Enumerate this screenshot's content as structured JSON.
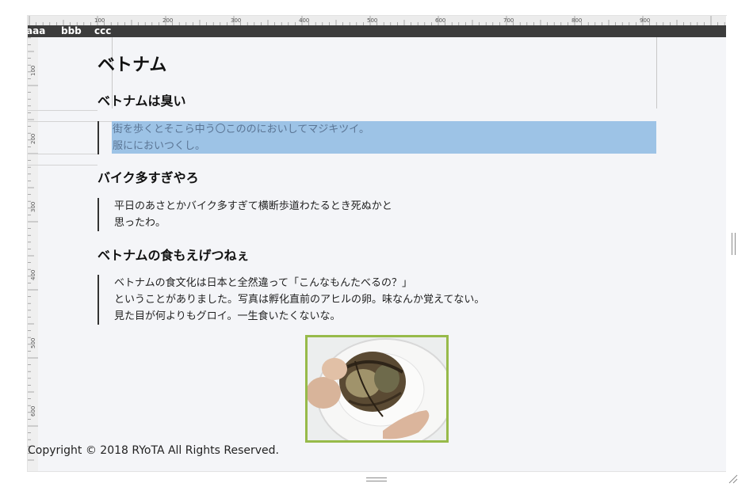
{
  "ruler": {
    "h_labels": [
      "100",
      "200",
      "300",
      "400",
      "500",
      "600",
      "700",
      "800",
      "900"
    ],
    "v_labels": [
      "100",
      "200",
      "300",
      "400",
      "500",
      "600"
    ]
  },
  "nav": {
    "items": [
      "aaa",
      "bbb",
      "ccc"
    ]
  },
  "page": {
    "h1": "ベトナム",
    "sections": [
      {
        "heading": "ベトナムは臭い",
        "lines": [
          "街を歩くとそこら中う〇こののにおいしてマジキツイ。",
          "服ににおいつくし。"
        ]
      },
      {
        "heading": "バイク多すぎやろ",
        "lines": [
          "平日のあさとかバイク多すぎて横断歩道わたるとき死ぬかと",
          "思ったわ。"
        ]
      },
      {
        "heading": "ベトナムの食もえげつねぇ",
        "lines": [
          "ベトナムの食文化は日本と全然違って「こんなもんたべるの？」",
          "ということがありました。写真は孵化直前のアヒルの卵。味なんか覚えてない。",
          "見た目が何よりもグロイ。一生食いたくないな。"
        ]
      }
    ],
    "photo_icon": "balut-egg-photo",
    "footer": "Copyright © 2018 RYoTA All Rights Reserved."
  },
  "colors": {
    "navbar": "#3c3c3c",
    "highlight": "#9dc3e6",
    "photo_border": "#97ba4a",
    "background": "#f4f5f8"
  }
}
